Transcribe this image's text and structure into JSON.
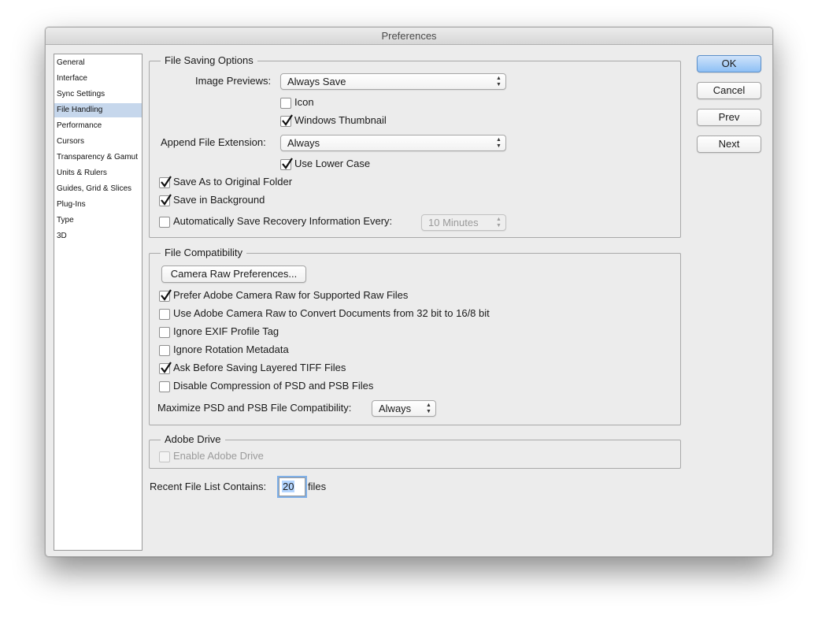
{
  "window": {
    "title": "Preferences"
  },
  "sidebar": {
    "items": [
      {
        "label": "General"
      },
      {
        "label": "Interface"
      },
      {
        "label": "Sync Settings"
      },
      {
        "label": "File Handling",
        "selected": true
      },
      {
        "label": "Performance"
      },
      {
        "label": "Cursors"
      },
      {
        "label": "Transparency & Gamut"
      },
      {
        "label": "Units & Rulers"
      },
      {
        "label": "Guides, Grid & Slices"
      },
      {
        "label": "Plug-Ins"
      },
      {
        "label": "Type"
      },
      {
        "label": "3D"
      }
    ]
  },
  "file_saving": {
    "legend": "File Saving Options",
    "image_previews_label": "Image Previews:",
    "image_previews_value": "Always Save",
    "icon_label": "Icon",
    "icon_checked": false,
    "windows_thumbnail_label": "Windows Thumbnail",
    "windows_thumbnail_checked": true,
    "append_ext_label": "Append File Extension:",
    "append_ext_value": "Always",
    "use_lower_case_label": "Use Lower Case",
    "use_lower_case_checked": true,
    "save_as_original_label": "Save As to Original Folder",
    "save_as_original_checked": true,
    "save_background_label": "Save in Background",
    "save_background_checked": true,
    "auto_save_label": "Automatically Save Recovery Information Every:",
    "auto_save_checked": false,
    "auto_save_interval": "10 Minutes"
  },
  "file_compat": {
    "legend": "File Compatibility",
    "camera_raw_button": "Camera Raw Preferences...",
    "options": [
      {
        "label": "Prefer Adobe Camera Raw for Supported Raw Files",
        "checked": true
      },
      {
        "label": "Use Adobe Camera Raw to Convert Documents from 32 bit to 16/8 bit",
        "checked": false
      },
      {
        "label": "Ignore EXIF Profile Tag",
        "checked": false
      },
      {
        "label": "Ignore Rotation Metadata",
        "checked": false
      },
      {
        "label": "Ask Before Saving Layered TIFF Files",
        "checked": true
      },
      {
        "label": "Disable Compression of PSD and PSB Files",
        "checked": false
      }
    ],
    "maximize_label": "Maximize PSD and PSB File Compatibility:",
    "maximize_value": "Always"
  },
  "adobe_drive": {
    "legend": "Adobe Drive",
    "enable_label": "Enable Adobe Drive",
    "enable_checked": false
  },
  "recent_files": {
    "label": "Recent File List Contains:",
    "value": "20",
    "suffix": "files"
  },
  "buttons": {
    "ok": "OK",
    "cancel": "Cancel",
    "prev": "Prev",
    "next": "Next"
  },
  "colors": {
    "selection": "#c6d7ec",
    "default_button": "#8ec0f5",
    "window_bg": "#ececec"
  }
}
